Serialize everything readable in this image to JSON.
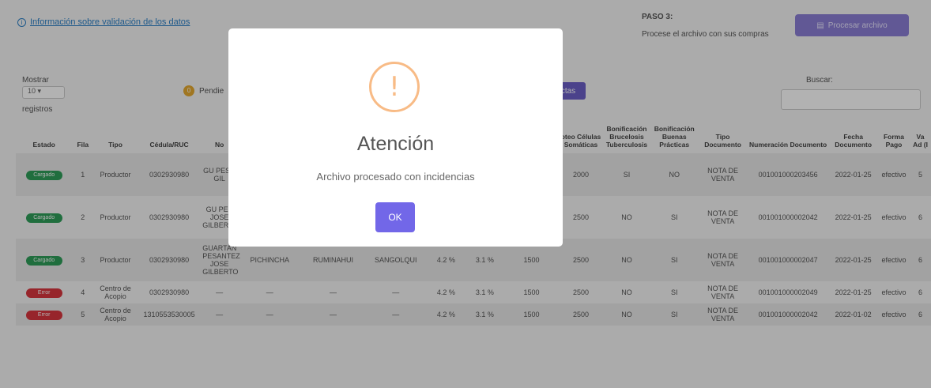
{
  "header": {
    "info_icon": "info-circle-icon",
    "info_link": "Información sobre validación de los datos",
    "paso_title": "PASO 3:",
    "paso_sub": "Procese el archivo con sus compras",
    "process_button": "Procesar archivo",
    "process_icon": "file-icon"
  },
  "toolbar": {
    "mostrar": "Mostrar",
    "length_value": "10",
    "registros": "registros",
    "pending_count": "0",
    "pending_label": "Pendie",
    "purple_button": "ctas",
    "search_label": "Buscar:",
    "search_value": ""
  },
  "table": {
    "headers": [
      "Estado",
      "Fila",
      "Tipo",
      "Cédula/RUC",
      "No",
      "",
      "",
      "",
      "",
      "",
      "",
      "oteo Células Somáticas",
      "Bonificación Brucelosis Tuberculosis",
      "Bonificación Buenas Prácticas",
      "Tipo Documento",
      "Numeración Documento",
      "Fecha Documento",
      "Forma Pago",
      "Va Ad (I"
    ],
    "rows": [
      {
        "estado": "Cargado",
        "status": "ok",
        "fila": "1",
        "tipo": "Productor",
        "cedula": "0302930980",
        "nombre": "GU PES J GIL",
        "provincia": "",
        "canton": "",
        "parroquia": "",
        "p1": "",
        "p2": "",
        "p3": "",
        "celulas": "2000",
        "bruc": "SI",
        "bp": "NO",
        "tipo_doc": "NOTA DE VENTA",
        "numeracion": "001001000203456",
        "fecha": "2022-01-25",
        "pago": "efectivo",
        "va": "5"
      },
      {
        "estado": "Cargado",
        "status": "ok",
        "fila": "2",
        "tipo": "Productor",
        "cedula": "0302930980",
        "nombre": "GU PES JOSE GILBERTO",
        "provincia": "",
        "canton": "",
        "parroquia": "",
        "p1": "",
        "p2": "",
        "p3": "",
        "celulas": "2500",
        "bruc": "NO",
        "bp": "SI",
        "tipo_doc": "NOTA DE VENTA",
        "numeracion": "001001000002042",
        "fecha": "2022-01-25",
        "pago": "efectivo",
        "va": "6"
      },
      {
        "estado": "Cargado",
        "status": "ok",
        "fila": "3",
        "tipo": "Productor",
        "cedula": "0302930980",
        "nombre": "GUARTAN PESANTEZ JOSE GILBERTO",
        "provincia": "PICHINCHA",
        "canton": "RUMINAHUI",
        "parroquia": "SANGOLQUI",
        "p1": "4.2 %",
        "p2": "3.1 %",
        "p3": "1500",
        "celulas": "2500",
        "bruc": "NO",
        "bp": "SI",
        "tipo_doc": "NOTA DE VENTA",
        "numeracion": "001001000002047",
        "fecha": "2022-01-25",
        "pago": "efectivo",
        "va": "6"
      },
      {
        "estado": "Error",
        "status": "err",
        "fila": "4",
        "tipo": "Centro de Acopio",
        "cedula": "0302930980",
        "nombre": "—",
        "provincia": "—",
        "canton": "—",
        "parroquia": "—",
        "p1": "4.2 %",
        "p2": "3.1 %",
        "p3": "1500",
        "celulas": "2500",
        "bruc": "NO",
        "bp": "SI",
        "tipo_doc": "NOTA DE VENTA",
        "numeracion": "001001000002049",
        "fecha": "2022-01-25",
        "pago": "efectivo",
        "va": "6"
      },
      {
        "estado": "Error",
        "status": "err",
        "fila": "5",
        "tipo": "Centro de Acopio",
        "cedula": "1310553530005",
        "nombre": "—",
        "provincia": "—",
        "canton": "—",
        "parroquia": "—",
        "p1": "4.2 %",
        "p2": "3.1 %",
        "p3": "1500",
        "celulas": "2500",
        "bruc": "NO",
        "bp": "SI",
        "tipo_doc": "NOTA DE VENTA",
        "numeracion": "001001000002042",
        "fecha": "2022-01-02",
        "pago": "efectivo",
        "va": "6"
      }
    ]
  },
  "modal": {
    "icon": "exclamation-icon",
    "icon_glyph": "!",
    "title": "Atención",
    "text": "Archivo procesado con incidencias",
    "ok_button": "OK"
  }
}
